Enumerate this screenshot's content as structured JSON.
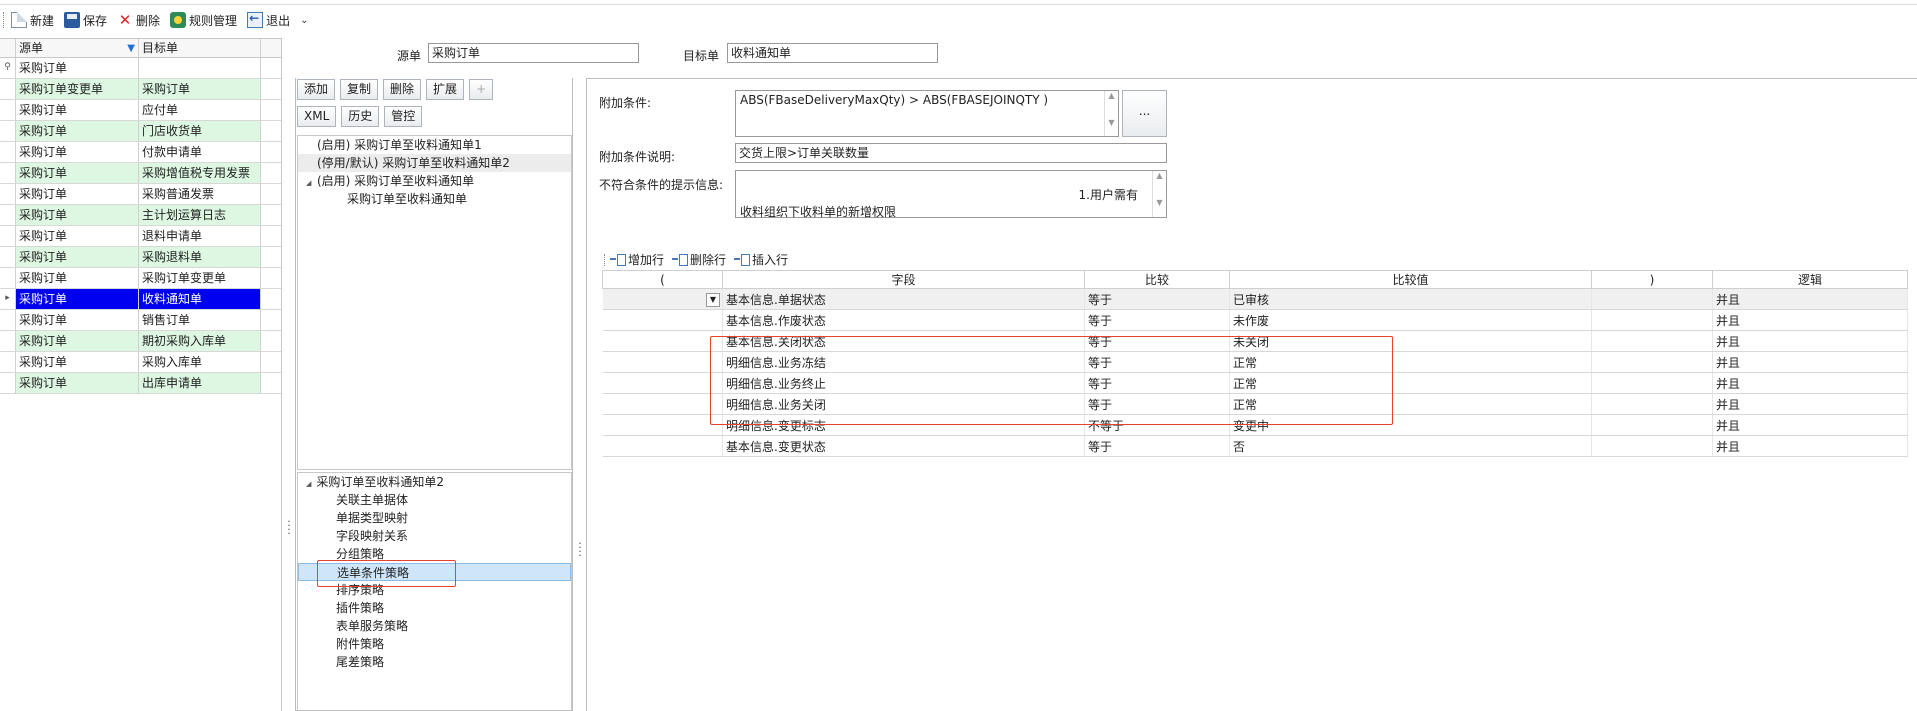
{
  "toolbar": {
    "new_label": "新建",
    "save_label": "保存",
    "delete_label": "删除",
    "rules_label": "规则管理",
    "exit_label": "退出",
    "more_caret": "⌄"
  },
  "left_grid": {
    "col_source": "源单",
    "col_target": "目标单",
    "filter_row": {
      "source": "采购订单",
      "target": ""
    },
    "rows": [
      {
        "source": "采购订单变更单",
        "target": "采购订单",
        "style": "green"
      },
      {
        "source": "采购订单",
        "target": "应付单",
        "style": "plain"
      },
      {
        "source": "采购订单",
        "target": "门店收货单",
        "style": "green"
      },
      {
        "source": "采购订单",
        "target": "付款申请单",
        "style": "plain"
      },
      {
        "source": "采购订单",
        "target": "采购增值税专用发票",
        "style": "green"
      },
      {
        "source": "采购订单",
        "target": "采购普通发票",
        "style": "plain"
      },
      {
        "source": "采购订单",
        "target": "主计划运算日志",
        "style": "green"
      },
      {
        "source": "采购订单",
        "target": "退料申请单",
        "style": "plain"
      },
      {
        "source": "采购订单",
        "target": "采购退料单",
        "style": "green"
      },
      {
        "source": "采购订单",
        "target": "采购订单变更单",
        "style": "plain"
      },
      {
        "source": "采购订单",
        "target": "收料通知单",
        "style": "sel"
      },
      {
        "source": "采购订单",
        "target": "销售订单",
        "style": "plain"
      },
      {
        "source": "采购订单",
        "target": "期初采购入库单",
        "style": "green"
      },
      {
        "source": "采购订单",
        "target": "采购入库单",
        "style": "plain"
      },
      {
        "source": "采购订单",
        "target": "出库申请单",
        "style": "green"
      }
    ]
  },
  "header": {
    "source_label": "源单",
    "source_value": "采购订单",
    "target_label": "目标单",
    "target_value": "收料通知单"
  },
  "mid": {
    "buttons_row1": [
      "添加",
      "复制",
      "删除",
      "扩展",
      "+"
    ],
    "buttons_row2": [
      "XML",
      "历史",
      "管控"
    ],
    "rules": [
      {
        "text": "(启用) 采购订单至收料通知单1",
        "expander": "",
        "indent": 0,
        "hl": false
      },
      {
        "text": "(停用/默认) 采购订单至收料通知单2",
        "expander": "",
        "indent": 0,
        "hl": true
      },
      {
        "text": "(启用) 采购订单至收料通知单",
        "expander": "◢",
        "indent": 0,
        "hl": false
      },
      {
        "text": "采购订单至收料通知单",
        "expander": "",
        "indent": 1,
        "hl": false
      }
    ],
    "strategy_root": "采购订单至收料通知单2",
    "strategy_expander": "◢",
    "strategies": [
      {
        "text": "关联主单据体",
        "sel": false
      },
      {
        "text": "单据类型映射",
        "sel": false
      },
      {
        "text": "字段映射关系",
        "sel": false
      },
      {
        "text": "分组策略",
        "sel": false
      },
      {
        "text": "选单条件策略",
        "sel": true
      },
      {
        "text": "排序策略",
        "sel": false
      },
      {
        "text": "插件策略",
        "sel": false
      },
      {
        "text": "表单服务策略",
        "sel": false
      },
      {
        "text": "附件策略",
        "sel": false
      },
      {
        "text": "尾差策略",
        "sel": false
      }
    ]
  },
  "right": {
    "extra_cond_label": "附加条件:",
    "extra_cond_value": "ABS(FBaseDeliveryMaxQty) > ABS(FBASEJOINQTY )",
    "ellipsis_label": "...",
    "extra_desc_label": "附加条件说明:",
    "extra_desc_value": "交货上限>订单关联数量",
    "tip_label": "不符合条件的提示信息:",
    "tip_line1": "1.用户需有",
    "tip_line2": "收料组织下收料单的新增权限",
    "grid_toolbar": {
      "add_row": "增加行",
      "delete_row": "删除行",
      "insert_row": "插入行"
    },
    "columns": [
      "(",
      "字段",
      "比较",
      "比较值",
      ")",
      "逻辑"
    ],
    "rows": [
      {
        "lparen": "",
        "field": "基本信息.单据状态",
        "compare": "等于",
        "value": "已审核",
        "rparen": "",
        "logic": "并且"
      },
      {
        "lparen": "",
        "field": "基本信息.作废状态",
        "compare": "等于",
        "value": "未作废",
        "rparen": "",
        "logic": "并且"
      },
      {
        "lparen": "",
        "field": "基本信息.关闭状态",
        "compare": "等于",
        "value": "未关闭",
        "rparen": "",
        "logic": "并且"
      },
      {
        "lparen": "",
        "field": "明细信息.业务冻结",
        "compare": "等于",
        "value": "正常",
        "rparen": "",
        "logic": "并且"
      },
      {
        "lparen": "",
        "field": "明细信息.业务终止",
        "compare": "等于",
        "value": "正常",
        "rparen": "",
        "logic": "并且"
      },
      {
        "lparen": "",
        "field": "明细信息.业务关闭",
        "compare": "等于",
        "value": "正常",
        "rparen": "",
        "logic": "并且"
      },
      {
        "lparen": "",
        "field": "明细信息.变更标志",
        "compare": "不等于",
        "value": "变更中",
        "rparen": "",
        "logic": "并且"
      },
      {
        "lparen": "",
        "field": "基本信息.变更状态",
        "compare": "等于",
        "value": "否",
        "rparen": "",
        "logic": "并且"
      }
    ]
  },
  "colors": {
    "selected_row": "#0000f0",
    "green_row": "#ddf7e2",
    "highlight_box": "#e8412c"
  }
}
